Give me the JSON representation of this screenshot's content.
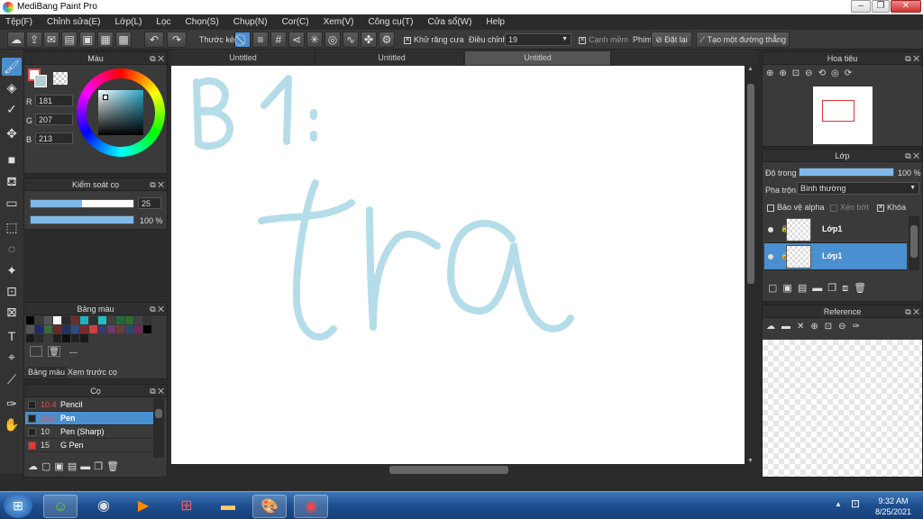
{
  "window": {
    "title": "MediBang Paint Pro"
  },
  "menu": [
    "Tệp(F)",
    "Chỉnh sửa(E)",
    "Lớp(L)",
    "Lọc",
    "Chọn(S)",
    "Chụp(N)",
    "Cor(C)",
    "Xem(V)",
    "Công cụ(T)",
    "Cửa sổ(W)",
    "Help"
  ],
  "toolbar": {
    "ruler_label": "Thước kẻ",
    "antialias_label": "Khử răng cưa",
    "correction_label": "Điều chỉnh",
    "correction_value": "19",
    "soft_edge_label": "Cạnh mềm",
    "key_label": "Phím",
    "reset_label": "Đặt lại",
    "make_line_label": "Tạo một đường thẳng"
  },
  "color_panel": {
    "title": "Màu",
    "r_label": "R",
    "g_label": "G",
    "b_label": "B",
    "r": "181",
    "g": "207",
    "b": "213",
    "main_color": "#b5cfd5"
  },
  "brush_control": {
    "title": "Kiểm soát cọ",
    "size": "25",
    "opacity": "100 %",
    "size_fill": 0.5,
    "opacity_fill": 1.0
  },
  "palette": {
    "title": "Bảng màu",
    "dots": "---",
    "tab_palette": "Bảng màu",
    "tab_preview": "Xem trước cọ",
    "colors": [
      "#000000",
      "#3a3a3a",
      "#555555",
      "#ffffff",
      "#2a2a2a",
      "#6b2f2f",
      "#20b0c0",
      "#303030",
      "#20c0c0",
      "#404040",
      "#1e6b3a",
      "#2f6b2f",
      "#444444",
      "#333333",
      "#555555",
      "#1e2a6b",
      "#3a6b3a",
      "#6b2a2a",
      "#203060",
      "#2a5080",
      "#7a2a2a",
      "#d04040",
      "#3a3a6b",
      "#6b3a6b",
      "#6b3a3a",
      "#2a4a6b",
      "#6b2a5a",
      "#000000",
      "#1a1a1a",
      "#2a2a2a",
      "#3a3a3a",
      "#202020",
      "#101010",
      "#222222",
      "#1a1a1a"
    ]
  },
  "brush_panel": {
    "title": "Cọ",
    "items": [
      {
        "size": "10.4",
        "name": "Pencil",
        "color": "#e05050",
        "selected": false
      },
      {
        "size": "26.0",
        "name": "Pen",
        "color": "#e05050",
        "selected": true
      },
      {
        "size": "10",
        "name": "Pen (Sharp)",
        "color": "#dddddd",
        "selected": false
      },
      {
        "size": "15",
        "name": "G Pen",
        "color": "#dddddd",
        "selected": false
      }
    ]
  },
  "tabs": [
    "Untitled",
    "Untitled",
    "Untitled"
  ],
  "navigator": {
    "title": "Hoa tiêu"
  },
  "layer_panel": {
    "title": "Lớp",
    "opacity_label": "Độ trong",
    "opacity_value": "100 %",
    "blend_label": "Pha trộn",
    "blend_value": "Bình thường",
    "protect_alpha": "Bảo vệ alpha",
    "clip": "Xén bớt",
    "lock": "Khóa",
    "layers": [
      {
        "name": "Lớp1",
        "selected": false
      },
      {
        "name": "Lớp1",
        "selected": true
      }
    ]
  },
  "reference_panel": {
    "title": "Reference"
  },
  "clock": {
    "time": "9:32 AM",
    "date": "8/25/2021"
  },
  "colors": {
    "accent": "#4a8fd0",
    "stroke": "#b5dde9"
  }
}
